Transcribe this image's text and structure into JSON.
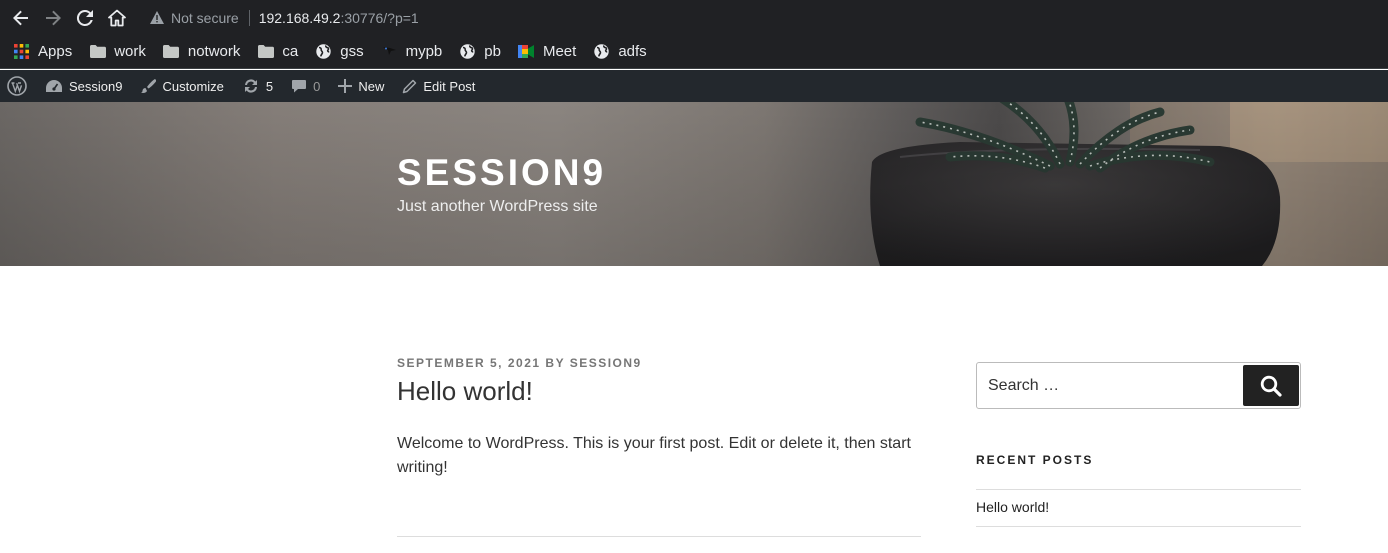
{
  "browser": {
    "security_label": "Not secure",
    "url_host": "192.168.49.2",
    "url_path": ":30776/?p=1"
  },
  "bookmarks": [
    {
      "label": "Apps",
      "icon": "apps-grid-icon"
    },
    {
      "label": "work",
      "icon": "folder-icon"
    },
    {
      "label": "notwork",
      "icon": "folder-icon"
    },
    {
      "label": "ca",
      "icon": "folder-icon"
    },
    {
      "label": "gss",
      "icon": "globe-icon"
    },
    {
      "label": "mypb",
      "icon": "bird-icon"
    },
    {
      "label": "pb",
      "icon": "globe-icon"
    },
    {
      "label": "Meet",
      "icon": "meet-icon"
    },
    {
      "label": "adfs",
      "icon": "globe-icon"
    }
  ],
  "adminbar": {
    "site_name": "Session9",
    "customize": "Customize",
    "updates_count": "5",
    "comments_count": "0",
    "new_label": "New",
    "edit_label": "Edit Post"
  },
  "header": {
    "title": "SESSION9",
    "description": "Just another WordPress site"
  },
  "post": {
    "date": "SEPTEMBER 5, 2021",
    "by": "BY",
    "author": "SESSION9",
    "title": "Hello world!",
    "body": "Welcome to WordPress. This is your first post. Edit or delete it, then start writing!"
  },
  "sidebar": {
    "search_placeholder": "Search …",
    "recent_title": "RECENT POSTS",
    "recent_posts": [
      "Hello world!"
    ]
  },
  "colors": {
    "toolbar_bg": "#202124",
    "adminbar_bg": "#23282d",
    "search_button": "#222222"
  }
}
